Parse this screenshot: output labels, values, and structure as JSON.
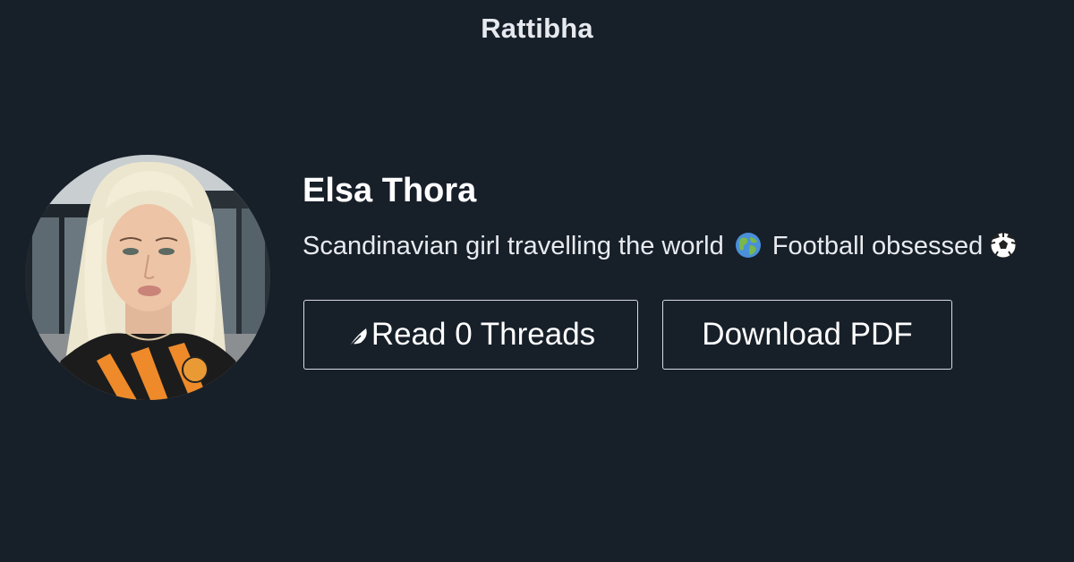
{
  "site": {
    "brand": "Rattibha"
  },
  "profile": {
    "name": "Elsa Thora",
    "bio_text": "Scandinavian girl travelling the world",
    "bio_text_2": "Football obsessed",
    "bio_emoji_1": "globe-icon",
    "bio_emoji_2": "soccer-ball-icon",
    "avatar_icon": "profile-photo"
  },
  "actions": {
    "read_label": "Read 0 Threads",
    "read_icon": "feather-icon",
    "download_label": "Download PDF"
  },
  "colors": {
    "background": "#171f29",
    "text": "#ffffff",
    "button_border": "#d8dce2"
  }
}
